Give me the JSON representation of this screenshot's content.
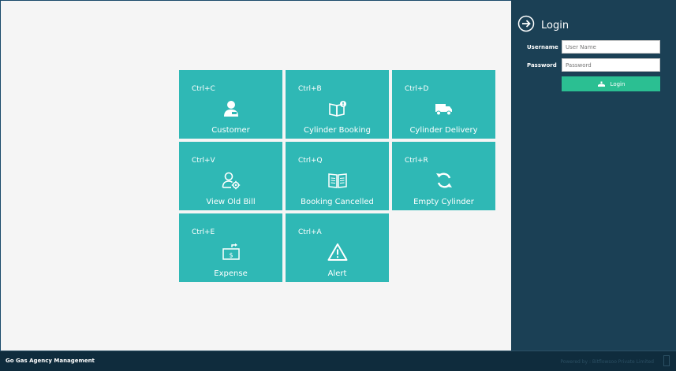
{
  "tiles": [
    {
      "shortcut": "Ctrl+C",
      "label": "Customer",
      "icon": "customer-icon"
    },
    {
      "shortcut": "Ctrl+B",
      "label": "Cylinder Booking",
      "icon": "booking-book-icon"
    },
    {
      "shortcut": "Ctrl+D",
      "label": "Cylinder Delivery",
      "icon": "delivery-truck-icon"
    },
    {
      "shortcut": "Ctrl+V",
      "label": "View Old Bill",
      "icon": "user-settings-icon"
    },
    {
      "shortcut": "Ctrl+Q",
      "label": "Booking Cancelled",
      "icon": "open-book-icon"
    },
    {
      "shortcut": "Ctrl+R",
      "label": "Empty Cylinder",
      "icon": "refresh-icon"
    },
    {
      "shortcut": "Ctrl+E",
      "label": "Expense",
      "icon": "expense-icon"
    },
    {
      "shortcut": "Ctrl+A",
      "label": "Alert",
      "icon": "alert-triangle-icon"
    }
  ],
  "login": {
    "title": "Login",
    "username_label": "Username",
    "username_placeholder": "User Name",
    "password_label": "Password",
    "password_placeholder": "Password",
    "button_label": "Login"
  },
  "footer": {
    "app_name": "Go Gas Agency Management",
    "powered_by": "Powered by : Bitflowsoo Private Limited"
  },
  "colors": {
    "tile": "#2fb8b5",
    "sidebar": "#1b4055",
    "login_button": "#2bbf92",
    "footer": "#0f2c3d"
  }
}
